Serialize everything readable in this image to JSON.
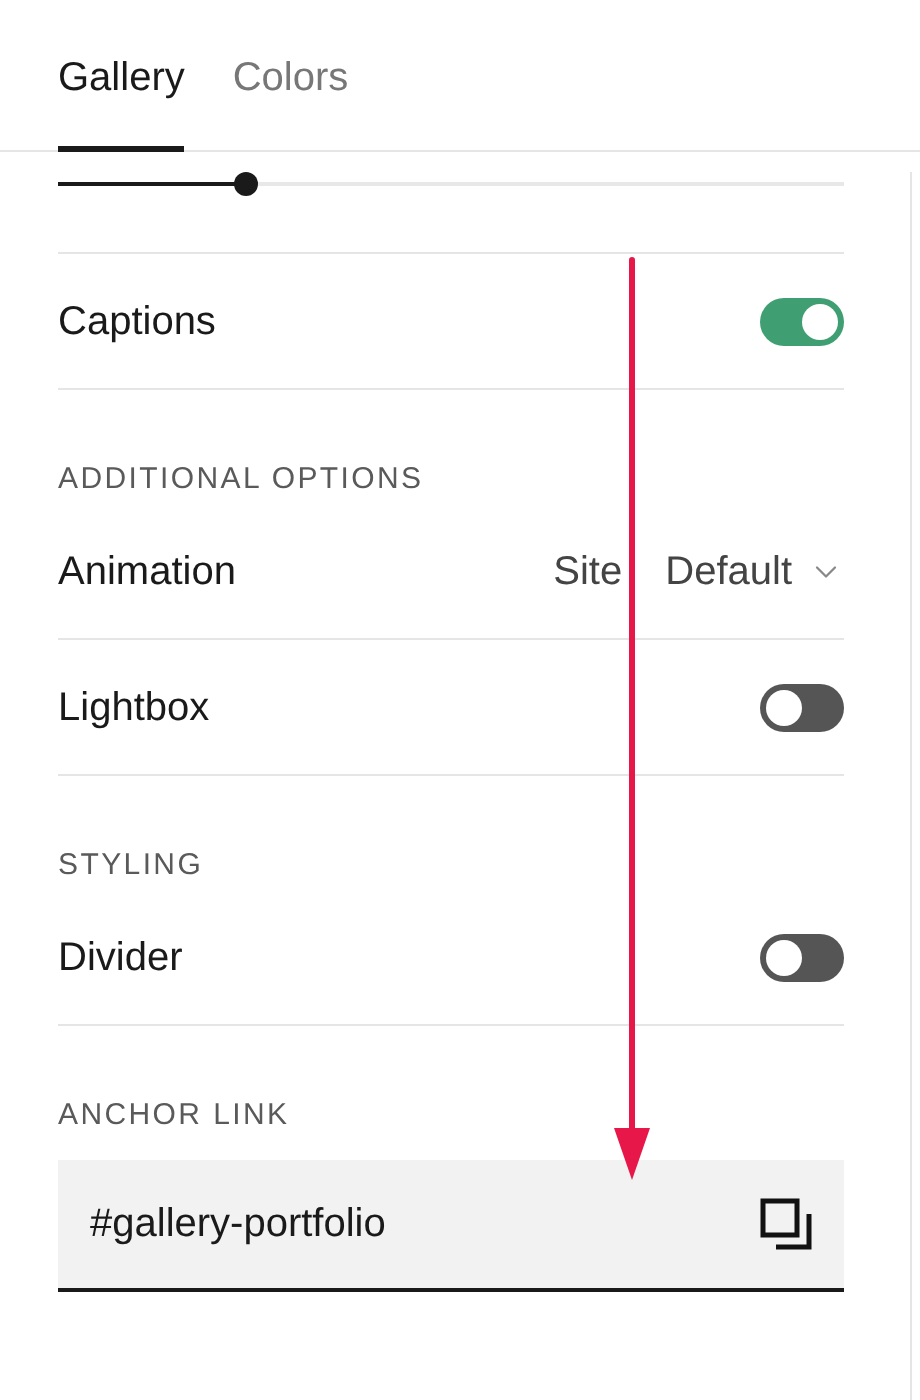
{
  "tabs": [
    {
      "label": "Gallery",
      "selected": true
    },
    {
      "label": "Colors",
      "selected": false
    }
  ],
  "slider": {
    "level": 0.24
  },
  "items": [
    {
      "kind": "toggle",
      "label": "Captions",
      "on": true
    },
    {
      "kind": "section",
      "label": "ADDITIONAL OPTIONS"
    },
    {
      "kind": "select",
      "label": "Animation",
      "value": "Site Default"
    },
    {
      "kind": "toggle",
      "label": "Lightbox",
      "on": false
    },
    {
      "kind": "section",
      "label": "STYLING"
    },
    {
      "kind": "toggle",
      "label": "Divider",
      "on": false
    },
    {
      "kind": "section",
      "label": "ANCHOR LINK"
    },
    {
      "kind": "field",
      "value": "#gallery-portfolio"
    }
  ]
}
